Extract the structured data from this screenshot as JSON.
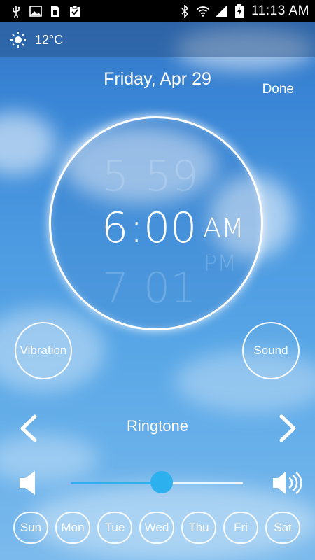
{
  "status_bar": {
    "time": "11:13 AM",
    "left_icons": [
      "usb-icon",
      "image-icon",
      "sim-icon",
      "clipboard-icon"
    ],
    "right_icons": [
      "bluetooth-icon",
      "wifi-icon",
      "signal-icon",
      "battery-charging-icon"
    ]
  },
  "weather": {
    "icon": "sun-icon",
    "temperature": "12°C"
  },
  "header": {
    "date": "Friday, Apr 29",
    "done_label": "Done"
  },
  "time_picker": {
    "hour_prev": "5",
    "minute_prev": "59",
    "hour": "6",
    "separator": ":",
    "minute": "00",
    "ampm": "AM",
    "hour_next": "7",
    "minute_next": "01",
    "ampm_next": "PM"
  },
  "toggles": {
    "vibration_label": "Vibration",
    "sound_label": "Sound"
  },
  "ringtone": {
    "label": "Ringtone"
  },
  "volume": {
    "level": 0.53,
    "accent": "#2cb0ee"
  },
  "days": [
    "Sun",
    "Mon",
    "Tue",
    "Wed",
    "Thu",
    "Fri",
    "Sat"
  ]
}
